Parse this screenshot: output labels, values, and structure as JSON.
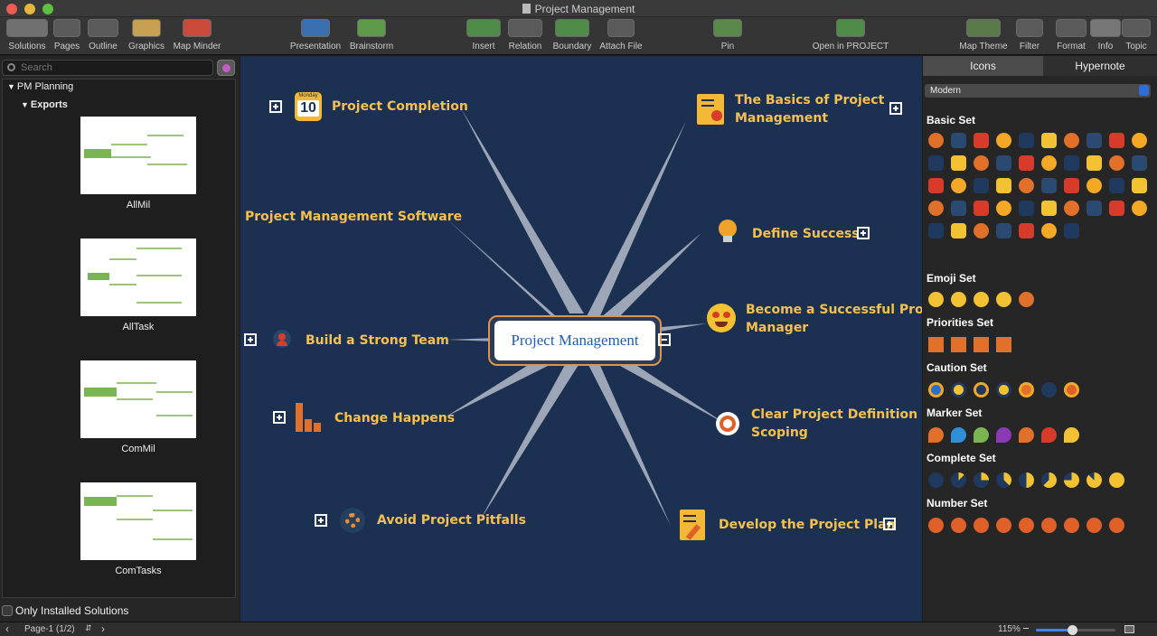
{
  "window": {
    "title": "Project Management"
  },
  "toolbar": {
    "solutions": "Solutions",
    "pages": "Pages",
    "outline": "Outline",
    "graphics": "Graphics",
    "map_minder": "Map Minder",
    "presentation": "Presentation",
    "brainstorm": "Brainstorm",
    "insert": "Insert",
    "relation": "Relation",
    "boundary": "Boundary",
    "attach_file": "Attach File",
    "pin": "Pin",
    "open_in_project": "Open in PROJECT",
    "map_theme": "Map Theme",
    "filter": "Filter",
    "format": "Format",
    "info": "Info",
    "topic": "Topic"
  },
  "left_panel": {
    "search_placeholder": "Search",
    "tree_root": "PM Planning",
    "tree_folder": "Exports",
    "exports": [
      {
        "label": "AllMil"
      },
      {
        "label": "AllTask"
      },
      {
        "label": "ComMil"
      },
      {
        "label": "ComTasks"
      }
    ],
    "only_installed": "Only Installed Solutions"
  },
  "mindmap": {
    "central": "Project Management",
    "calendar_icon": {
      "day": "Monday",
      "date": "10"
    },
    "topics": {
      "completion": "Project Completion",
      "software": "Project Management Software",
      "team": "Build a Strong Team",
      "change": "Change Happens",
      "pitfalls": "Avoid Project Pitfalls",
      "basics_1": "The Basics of Project",
      "basics_2": "Management",
      "success": "Define Success",
      "manager_1": "Become a Successful Projec",
      "manager_2": "Manager",
      "scoping_1": "Clear Project Definition an",
      "scoping_2": "Scoping",
      "plan": "Develop the Project Plan"
    }
  },
  "right_panel": {
    "tab_icons": "Icons",
    "tab_hypernote": "Hypernote",
    "theme": "Modern",
    "sets": {
      "basic": "Basic Set",
      "emoji": "Emoji Set",
      "priorities": "Priorities Set",
      "caution": "Caution Set",
      "marker": "Marker Set",
      "complete": "Complete Set",
      "number": "Number Set"
    },
    "colors": {
      "accent": "#f4a226",
      "navy": "#1c3152",
      "red": "#d93b2b"
    }
  },
  "status": {
    "page": "Page-1 (1/2)",
    "zoom": "115%",
    "zoom_level": 0.45
  }
}
